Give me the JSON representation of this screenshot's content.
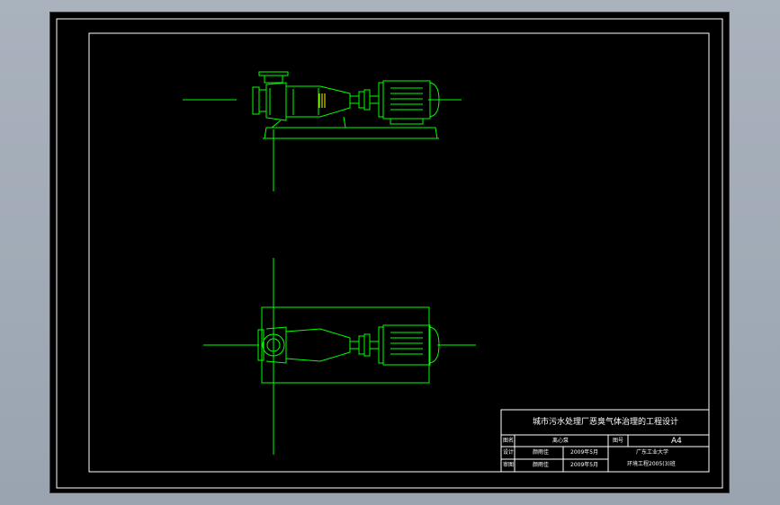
{
  "colors": {
    "background": "#9aa4b0",
    "canvas": "#000000",
    "frame": "#ffffff",
    "drawing": "#00ff00",
    "accent": "#ffff00"
  },
  "title_block": {
    "title": "城市污水处理厂恶臭气体治理的工程设计",
    "name_label": "图名",
    "name_value": "离心泵",
    "number_label": "图号",
    "number_value": "A4",
    "design_label": "设计",
    "design_value": "颜雨佳",
    "design_date": "2009年5月",
    "check_label": "审图",
    "check_value": "颜雨佳",
    "check_date": "2009年5月",
    "school": "广东工业大学",
    "class": "环境工程2005(3)班"
  }
}
